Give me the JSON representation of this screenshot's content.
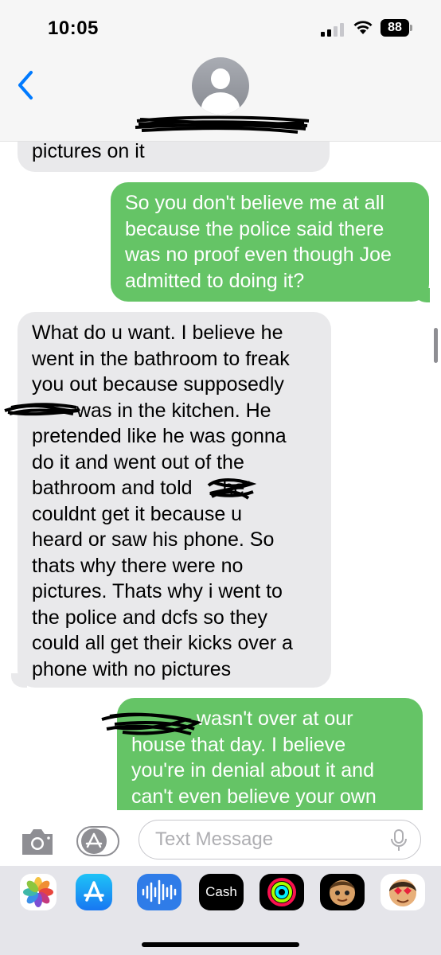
{
  "status": {
    "time": "10:05",
    "battery": "88"
  },
  "messages": [
    {
      "type": "incoming",
      "text": "pictures on it"
    },
    {
      "type": "outgoing",
      "text": "So you don't believe me at all because the police said there was no proof even though Joe admitted to doing it?"
    },
    {
      "type": "incoming",
      "lines": [
        "What do u want. I believe he",
        "went in the bathroom to freak",
        "you out because supposedly",
        "was in the kitchen. He",
        "pretended like he was gonna",
        "do it and went out of the",
        "bathroom and told",
        "he",
        "couldnt get it because u",
        "heard or saw his phone. So",
        "thats why there were no",
        "pictures. Thats why i went to",
        "the police and dcfs so they",
        "could all get their kicks over a",
        "phone with no pictures"
      ]
    },
    {
      "type": "outgoing",
      "lines": [
        "wasn't over at our",
        "house that day. I believe",
        "you're in denial about it and",
        "can't even believe your own"
      ]
    }
  ],
  "input": {
    "placeholder": "Text Message"
  },
  "apps": [
    "photos-icon",
    "app-store-icon",
    "audio-message-icon",
    "apple-cash-icon",
    "fitness-icon",
    "memoji-icon",
    "memoji-stickers-icon"
  ],
  "apple_cash_label": "Cash",
  "colors": {
    "outgoing": "#65c466",
    "incoming": "#e9e9eb",
    "accent": "#007aff"
  }
}
